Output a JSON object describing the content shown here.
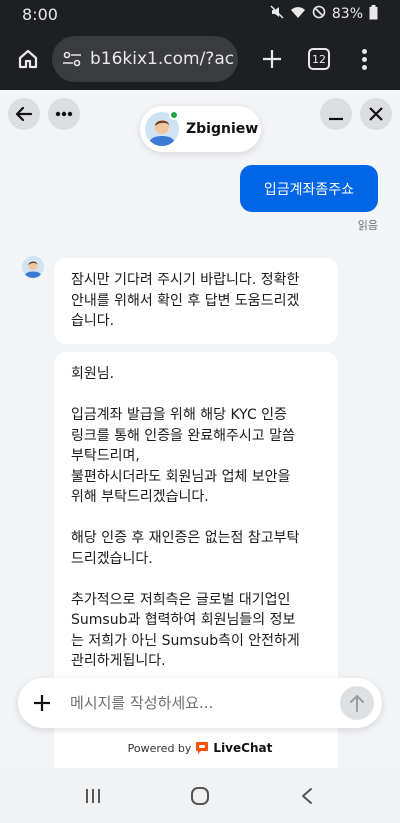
{
  "status_bar": {
    "time": "8:00",
    "battery": "83%"
  },
  "browser": {
    "url": "b16kix1.com/?ac",
    "tab_count": "12"
  },
  "agent": {
    "name": "Zbigniew",
    "status_color": "#1ea446"
  },
  "messages": {
    "outgoing": {
      "text": "입금계좌좀주쇼",
      "read_label": "읽음"
    },
    "incoming_1": [
      "잠시만 기다려 주시기 바랍니다. 정확한",
      "안내를 위해서 확인 후 답변 도움드리겠",
      "습니다."
    ],
    "incoming_2": [
      "회원님.",
      "",
      "입금계좌 발급을 위해 해당 KYC 인증",
      "링크를 통해 인증을 완료해주시고 말씀",
      "부탁드리며,",
      "불편하시더라도 회원님과 업체 보안을",
      "위해 부탁드리겠습니다.",
      "",
      "해당 인증 후 재인증은 없는점 참고부탁",
      "드리겠습니다.",
      "",
      "추가적으로 저희측은 글로벌 대기업인",
      "Sumsub과 협력하여 회원님들의 정보",
      "는 저희가 아닌 Sumsub측이 안전하게",
      "관리하게됩니다.",
      ""
    ]
  },
  "composer": {
    "placeholder": "메시지를 작성하세요..."
  },
  "footer": {
    "powered_by": "Powered by",
    "brand": "LiveChat",
    "brand_color": "#ff5100"
  },
  "colors": {
    "accent": "#0066e6"
  }
}
